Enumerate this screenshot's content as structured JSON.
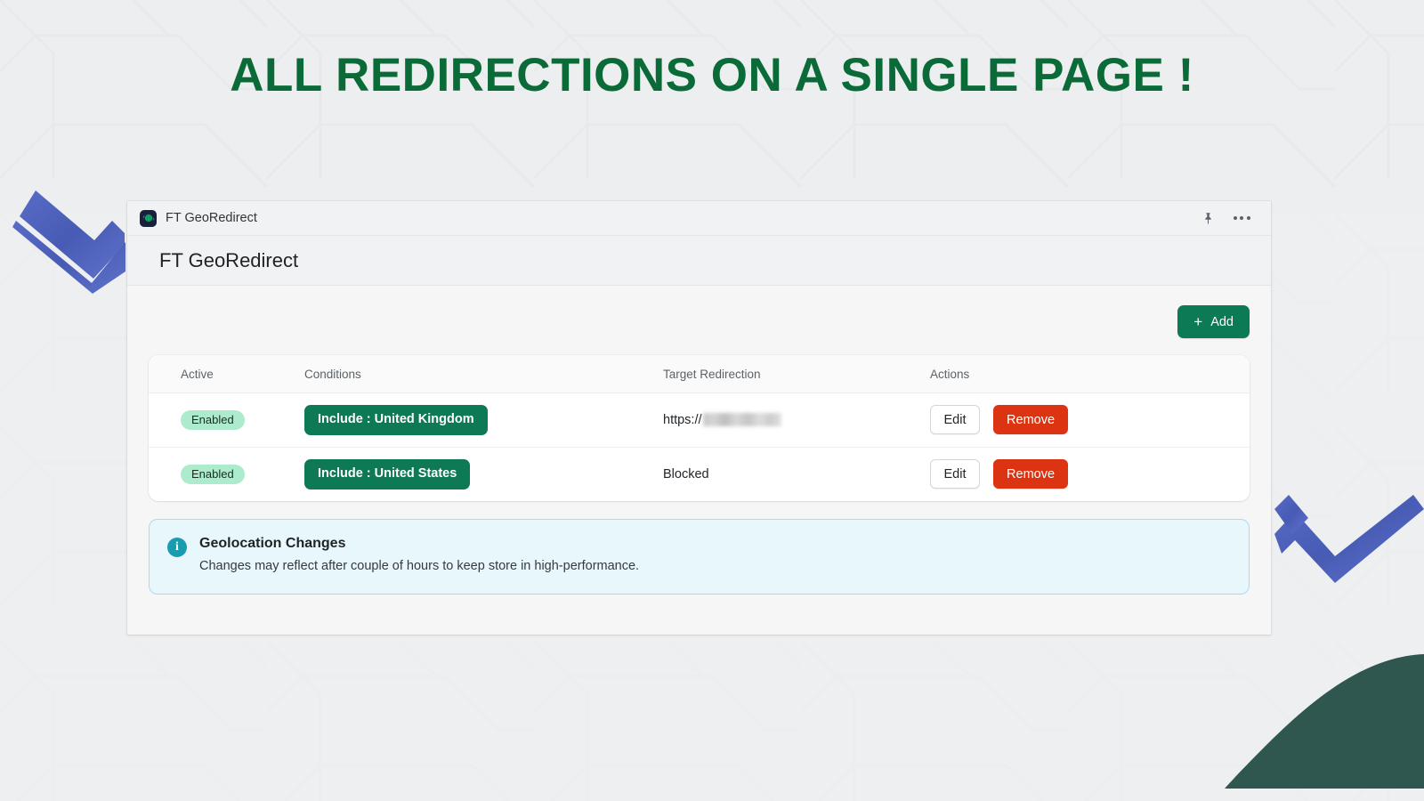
{
  "hero": {
    "title": "ALL REDIRECTIONS ON A SINGLE PAGE !",
    "color": "#0a6b38"
  },
  "window": {
    "app_icon_name": "globe-redirect-icon",
    "titlebar_title": "FT GeoRedirect",
    "pin_label": "Pin",
    "more_label": "More options",
    "page_title": "FT GeoRedirect"
  },
  "toolbar": {
    "add_label": "Add",
    "add_icon": "plus-icon",
    "add_color": "#0c7a54"
  },
  "table": {
    "columns": [
      "Active",
      "Conditions",
      "Target Redirection",
      "Actions"
    ],
    "rows": [
      {
        "active": "Enabled",
        "condition": "Include : United Kingdom",
        "target_prefix": "https://",
        "target_redacted": true,
        "edit_label": "Edit",
        "remove_label": "Remove"
      },
      {
        "active": "Enabled",
        "condition": "Include : United States",
        "target_prefix": "Blocked",
        "target_redacted": false,
        "edit_label": "Edit",
        "remove_label": "Remove"
      }
    ]
  },
  "info_banner": {
    "icon": "info-icon",
    "title": "Geolocation Changes",
    "text": "Changes may reflect after couple of hours to keep store in high-performance.",
    "accent": "#1a9cb0",
    "background": "#e8f7fb"
  },
  "decorations": {
    "chevron_color": "#4158b8",
    "blob_color": "#2f5750"
  }
}
